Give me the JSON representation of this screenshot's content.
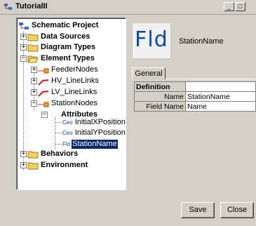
{
  "window": {
    "title": "TutorialII",
    "app_icon": "schematic-app-icon",
    "controls": [
      "minimize-icon",
      "maximize-icon"
    ]
  },
  "tree": {
    "root": {
      "label": "Schematic Project",
      "icon": "schematic-project-icon"
    },
    "items": [
      {
        "label": "Data Sources",
        "icon": "folder-icon"
      },
      {
        "label": "Diagram Types",
        "icon": "folder-icon"
      },
      {
        "label": "Element Types",
        "icon": "folder-open-icon"
      },
      {
        "label": "FeederNodes",
        "icon": "node-type-icon"
      },
      {
        "label": "HV_LineLinks",
        "icon": "link-type-icon"
      },
      {
        "label": "LV_LineLinks",
        "icon": "link-type-icon"
      },
      {
        "label": "StationNodes",
        "icon": "node-type-icon"
      },
      {
        "label": "Attributes",
        "icon": ""
      },
      {
        "label": "InitialXPosition",
        "icon": "calculated-attribute-icon",
        "badge": "Ceo"
      },
      {
        "label": "InitialYPosition",
        "icon": "calculated-attribute-icon",
        "badge": "Ceo"
      },
      {
        "label": "StationName",
        "icon": "field-attribute-icon",
        "badge": "Fld",
        "selected": true
      },
      {
        "label": "Behaviors",
        "icon": "folder-icon"
      },
      {
        "label": "Environment",
        "icon": "folder-icon"
      }
    ]
  },
  "detail": {
    "icon_text": "Fld",
    "name": "StationName",
    "tab": "General",
    "table": {
      "section": "Definition",
      "rows": [
        {
          "key": "Name",
          "value": "StationName"
        },
        {
          "key": "Field Name",
          "value": "Name"
        }
      ]
    }
  },
  "buttons": {
    "save": "Save",
    "close": "Close"
  },
  "colors": {
    "selection": "#0a246a",
    "folder": "#f4d060",
    "link": "#d01818"
  }
}
